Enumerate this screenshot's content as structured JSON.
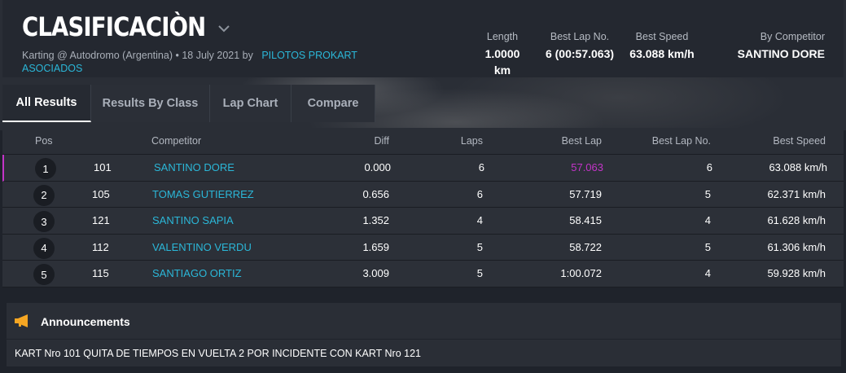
{
  "header": {
    "title": "CLASIFICACIÒN",
    "subtitle_prefix": "Karting @ Autodromo (Argentina) • 18 July 2021 by",
    "organizer": "PILOTOS PROKART ASOCIADOS",
    "stats": [
      {
        "label": "Length",
        "value": "1.0000 km"
      },
      {
        "label": "Best Lap No.",
        "value": "6 (00:57.063)"
      },
      {
        "label": "Best Speed",
        "value": "63.088 km/h"
      },
      {
        "label": "By Competitor",
        "value": "SANTINO DORE"
      }
    ]
  },
  "tabs": [
    "All Results",
    "Results By Class",
    "Lap Chart",
    "Compare"
  ],
  "table": {
    "columns": [
      "Pos",
      "Competitor",
      "Diff",
      "Laps",
      "Best Lap",
      "Best Lap No.",
      "Best Speed"
    ],
    "rows": [
      {
        "pos": "1",
        "number": "101",
        "competitor": "SANTINO DORE",
        "diff": "0.000",
        "laps": "6",
        "best_lap": "57.063",
        "best_lap_no": "6",
        "best_speed": "63.088 km/h"
      },
      {
        "pos": "2",
        "number": "105",
        "competitor": "TOMAS GUTIERREZ",
        "diff": "0.656",
        "laps": "6",
        "best_lap": "57.719",
        "best_lap_no": "5",
        "best_speed": "62.371 km/h"
      },
      {
        "pos": "3",
        "number": "121",
        "competitor": "SANTINO SAPIA",
        "diff": "1.352",
        "laps": "4",
        "best_lap": "58.415",
        "best_lap_no": "4",
        "best_speed": "61.628 km/h"
      },
      {
        "pos": "4",
        "number": "112",
        "competitor": "VALENTINO VERDU",
        "diff": "1.659",
        "laps": "5",
        "best_lap": "58.722",
        "best_lap_no": "5",
        "best_speed": "61.306 km/h"
      },
      {
        "pos": "5",
        "number": "115",
        "competitor": "SANTIAGO ORTIZ",
        "diff": "3.009",
        "laps": "5",
        "best_lap": "1:00.072",
        "best_lap_no": "4",
        "best_speed": "59.928 km/h"
      }
    ]
  },
  "announcements": {
    "title": "Announcements",
    "text": "KART Nro 101 QUITA DE TIEMPOS EN VUELTA 2 POR INCIDENTE CON KART Nro 121"
  },
  "colors": {
    "accent": "#2bb7d8",
    "best_lap_highlight": "#c334c8",
    "announcement_icon": "#f5a623"
  },
  "icons": {
    "title_dropdown": "chevron-down-icon",
    "announcements": "megaphone-icon"
  }
}
